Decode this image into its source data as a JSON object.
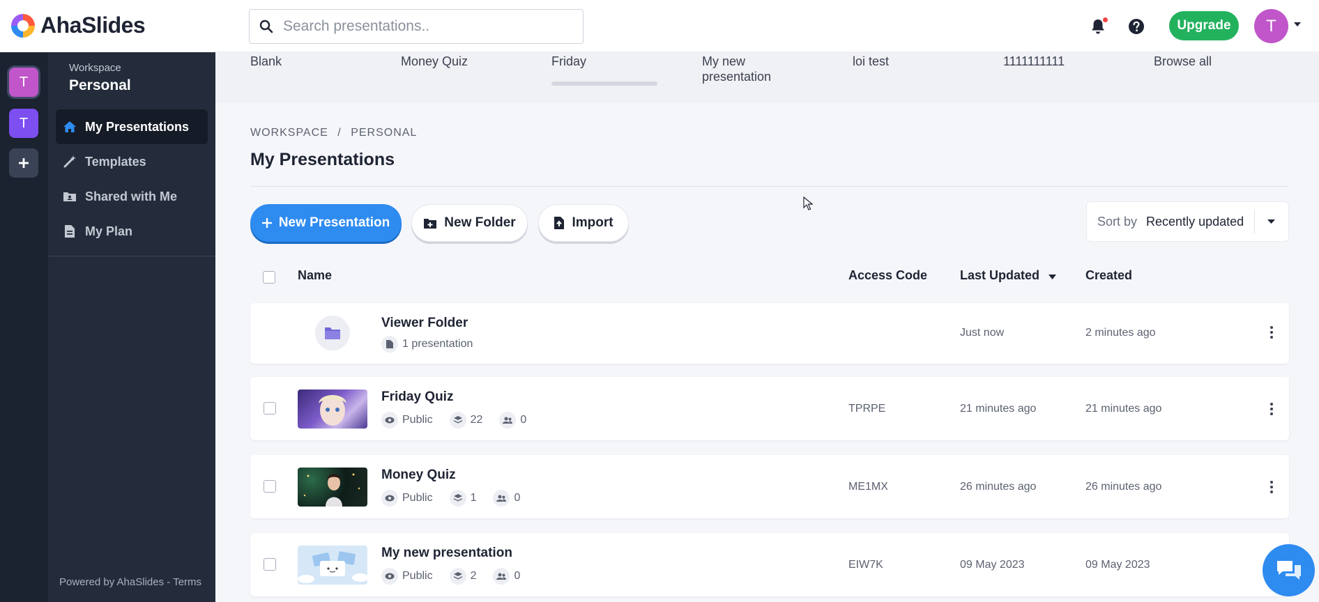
{
  "header": {
    "logo_text": "AhaSlides",
    "search_placeholder": "Search presentations..",
    "upgrade_label": "Upgrade",
    "avatar_initial": "T"
  },
  "rail": {
    "workspaces": [
      "T",
      "T"
    ],
    "add_label": "+"
  },
  "sidebar": {
    "workspace_caption": "Workspace",
    "workspace_name": "Personal",
    "items": [
      {
        "label": "My Presentations",
        "icon": "home-icon",
        "active": true
      },
      {
        "label": "Templates",
        "icon": "magic-wand-icon",
        "active": false
      },
      {
        "label": "Shared with Me",
        "icon": "shared-folder-icon",
        "active": false
      },
      {
        "label": "My Plan",
        "icon": "document-icon",
        "active": false
      }
    ],
    "footer": {
      "powered_by": "Powered by AhaSlides",
      "separator": "-",
      "terms": "Terms"
    }
  },
  "templates_strip": [
    "Blank",
    "Money Quiz",
    "Friday",
    "My new presentation",
    "loi test",
    "1111111111",
    "Browse all"
  ],
  "main": {
    "breadcrumb": {
      "root": "WORKSPACE",
      "separator": "/",
      "current": "PERSONAL"
    },
    "title": "My Presentations",
    "buttons": {
      "new_presentation": "New Presentation",
      "new_folder": "New Folder",
      "import": "Import"
    },
    "sort": {
      "label": "Sort by",
      "value": "Recently updated"
    },
    "table": {
      "columns": [
        "Name",
        "Access Code",
        "Last Updated",
        "Created"
      ],
      "rows": [
        {
          "type": "folder",
          "name": "Viewer Folder",
          "count": "1 presentation",
          "access_code": "",
          "last_updated": "Just now",
          "created": "2 minutes ago"
        },
        {
          "type": "presentation",
          "name": "Friday Quiz",
          "visibility": "Public",
          "slides": "22",
          "participants": "0",
          "access_code": "TPRPE",
          "last_updated": "21 minutes ago",
          "created": "21 minutes ago"
        },
        {
          "type": "presentation",
          "name": "Money Quiz",
          "visibility": "Public",
          "slides": "1",
          "participants": "0",
          "access_code": "ME1MX",
          "last_updated": "26 minutes ago",
          "created": "26 minutes ago"
        },
        {
          "type": "presentation",
          "name": "My new presentation",
          "visibility": "Public",
          "slides": "2",
          "participants": "0",
          "access_code": "EIW7K",
          "last_updated": "09 May 2023",
          "created": "09 May 2023"
        }
      ]
    }
  },
  "colors": {
    "primary": "#2e8bf0",
    "upgrade": "#22b25e",
    "sidebar_bg": "#242c3b",
    "rail_bg": "#1b2230",
    "avatar": "#c056c9",
    "workspace_secondary": "#7d4ef0"
  }
}
